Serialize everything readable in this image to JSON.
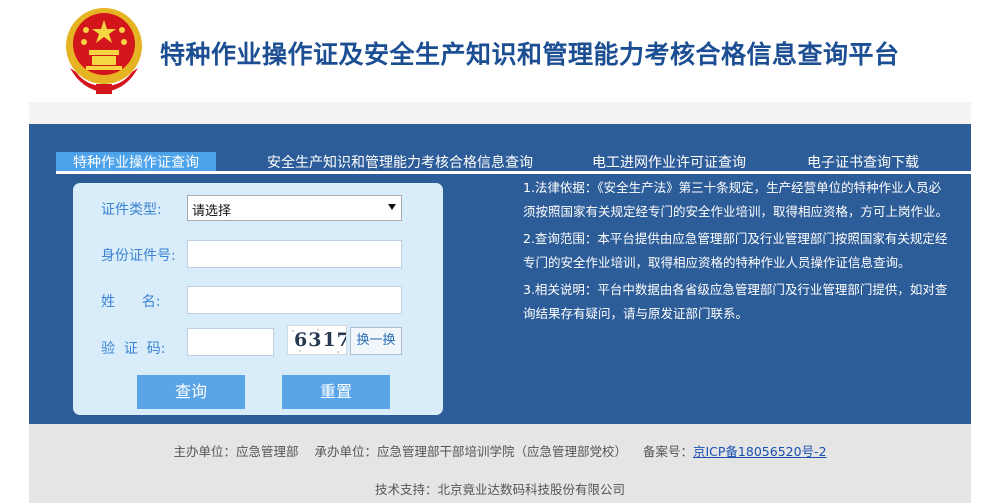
{
  "header": {
    "title": "特种作业操作证及安全生产知识和管理能力考核合格信息查询平台",
    "emblem_icon": "national-emblem-icon"
  },
  "tabs": [
    {
      "label": "特种作业操作证查询",
      "active": true
    },
    {
      "label": "安全生产知识和管理能力考核合格信息查询",
      "active": false
    },
    {
      "label": "电工进网作业许可证查询",
      "active": false
    },
    {
      "label": "电子证书查询下载",
      "active": false
    }
  ],
  "form": {
    "cert_type_label": "证件类型:",
    "cert_type_value": "请选择",
    "id_label": "身份证件号:",
    "name_label": "姓      名:",
    "captcha_label": "验  证  码:",
    "captcha_text": "6317",
    "refresh_label": "换一换",
    "query_button": "查询",
    "reset_button": "重置"
  },
  "notes": [
    "1.法律依据：《安全生产法》第三十条规定，生产经营单位的特种作业人员必须按照国家有关规定经专门的安全作业培训，取得相应资格，方可上岗作业。",
    "2.查询范围：本平台提供由应急管理部门及行业管理部门按照国家有关规定经专门的安全作业培训，取得相应资格的特种作业人员操作证信息查询。",
    "3.相关说明：平台中数据由各省级应急管理部门及行业管理部门提供，如对查询结果存有疑问，请与原发证部门联系。"
  ],
  "footer": {
    "host": "主办单位：应急管理部",
    "organizer": "承办单位：应急管理部干部培训学院（应急管理部党校）",
    "icp_label": "备案号：",
    "icp_link": "京ICP备18056520号-2",
    "support": "技术支持：北京竟业达数码科技股份有限公司"
  },
  "colors": {
    "panel": "#2d5d99",
    "active_tab": "#4da3ea",
    "form_bg": "#d8ecfa",
    "button": "#5aa4e8",
    "title": "#1c4e93"
  }
}
